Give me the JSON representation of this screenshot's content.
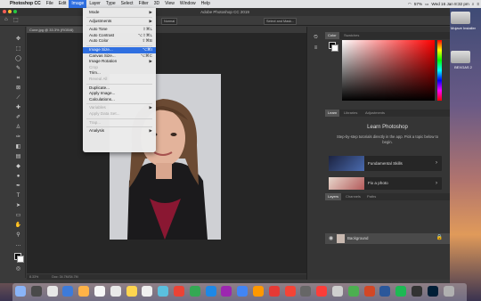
{
  "menubar": {
    "apple": "",
    "app": "Photoshop CC",
    "items": [
      "File",
      "Edit",
      "Image",
      "Layer",
      "Type",
      "Select",
      "Filter",
      "3D",
      "View",
      "Window",
      "Help"
    ],
    "status": {
      "battery": "57%",
      "datetime": "Wed 16 Jan 8:32 pm"
    }
  },
  "ps": {
    "title": "Adobe Photoshop CC 2019",
    "doc_tab": "Cone.jpg @ 33.3% (RGB/8)",
    "zoom_status": "8.33%",
    "doc_status": "Doc: 34.7M/34.7M",
    "options": {
      "normal": "Normal",
      "select_mask": "Select and Mask..."
    },
    "panels": {
      "color_tabs": [
        "Color",
        "Swatches"
      ],
      "learn_tabs": [
        "Learn",
        "Libraries",
        "Adjustments"
      ],
      "learn_title": "Learn Photoshop",
      "learn_desc": "Step-by-step tutorials directly in the app. Pick a topic below to begin.",
      "tutorials": [
        "Fundamental Skills",
        "Fix a photo"
      ],
      "layers_tabs": [
        "Layers",
        "Channels",
        "Paths"
      ],
      "layer_name": "Background"
    }
  },
  "image_menu": [
    {
      "label": "Mode",
      "shortcut": "▶",
      "disabled": false
    },
    {
      "sep": true
    },
    {
      "label": "Adjustments",
      "shortcut": "▶",
      "disabled": false
    },
    {
      "sep": true
    },
    {
      "label": "Auto Tone",
      "shortcut": "⇧⌘L",
      "disabled": false
    },
    {
      "label": "Auto Contrast",
      "shortcut": "⌥⇧⌘L",
      "disabled": false
    },
    {
      "label": "Auto Color",
      "shortcut": "⇧⌘B",
      "disabled": false
    },
    {
      "sep": true
    },
    {
      "label": "Image Size...",
      "shortcut": "⌥⌘I",
      "disabled": false,
      "highlight": true
    },
    {
      "label": "Canvas Size...",
      "shortcut": "⌥⌘C",
      "disabled": false
    },
    {
      "label": "Image Rotation",
      "shortcut": "▶",
      "disabled": false
    },
    {
      "label": "Crop",
      "shortcut": "",
      "disabled": true
    },
    {
      "label": "Trim...",
      "shortcut": "",
      "disabled": false
    },
    {
      "label": "Reveal All",
      "shortcut": "",
      "disabled": true
    },
    {
      "sep": true
    },
    {
      "label": "Duplicate...",
      "shortcut": "",
      "disabled": false
    },
    {
      "label": "Apply Image...",
      "shortcut": "",
      "disabled": false
    },
    {
      "label": "Calculations...",
      "shortcut": "",
      "disabled": false
    },
    {
      "sep": true
    },
    {
      "label": "Variables",
      "shortcut": "▶",
      "disabled": true
    },
    {
      "label": "Apply Data Set...",
      "shortcut": "",
      "disabled": true
    },
    {
      "sep": true
    },
    {
      "label": "Trap...",
      "shortcut": "",
      "disabled": true
    },
    {
      "sep": true
    },
    {
      "label": "Analysis",
      "shortcut": "▶",
      "disabled": false
    }
  ],
  "desktop": {
    "drive1": "Mojave Installer",
    "drive2": "BEXGAS 2"
  },
  "colors": {
    "menu_highlight": "#2f6fe0",
    "ps_bg": "#3a3a3a"
  }
}
